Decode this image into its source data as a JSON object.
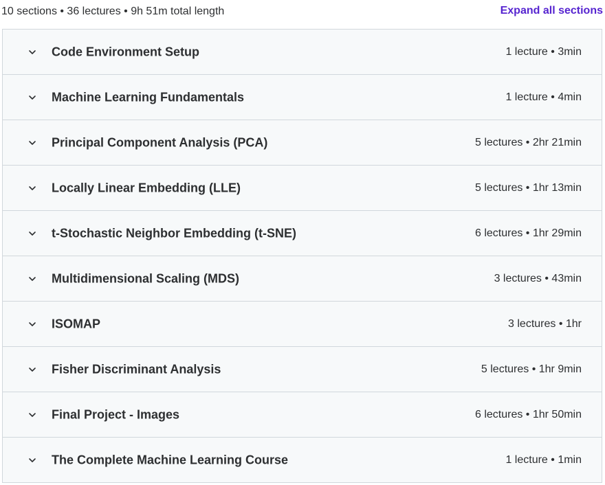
{
  "summary": {
    "text": "10 sections • 36 lectures • 9h 51m total length",
    "expand_label": "Expand all sections"
  },
  "colors": {
    "accent": "#5624d0",
    "row_background": "#f7f9fa",
    "border": "#d1d7dc",
    "text": "#2d2f31"
  },
  "icons": {
    "row_toggle": "chevron-down-icon"
  },
  "sections": [
    {
      "title": "Code Environment Setup",
      "meta": "1 lecture • 3min"
    },
    {
      "title": "Machine Learning Fundamentals",
      "meta": "1 lecture • 4min"
    },
    {
      "title": "Principal Component Analysis (PCA)",
      "meta": "5 lectures • 2hr 21min"
    },
    {
      "title": "Locally Linear Embedding (LLE)",
      "meta": "5 lectures • 1hr 13min"
    },
    {
      "title": "t-Stochastic Neighbor Embedding (t-SNE)",
      "meta": "6 lectures • 1hr 29min"
    },
    {
      "title": "Multidimensional Scaling (MDS)",
      "meta": "3 lectures • 43min"
    },
    {
      "title": "ISOMAP",
      "meta": "3 lectures • 1hr"
    },
    {
      "title": "Fisher Discriminant Analysis",
      "meta": "5 lectures • 1hr 9min"
    },
    {
      "title": "Final Project - Images",
      "meta": "6 lectures • 1hr 50min"
    },
    {
      "title": "The Complete Machine Learning Course",
      "meta": "1 lecture • 1min"
    }
  ]
}
